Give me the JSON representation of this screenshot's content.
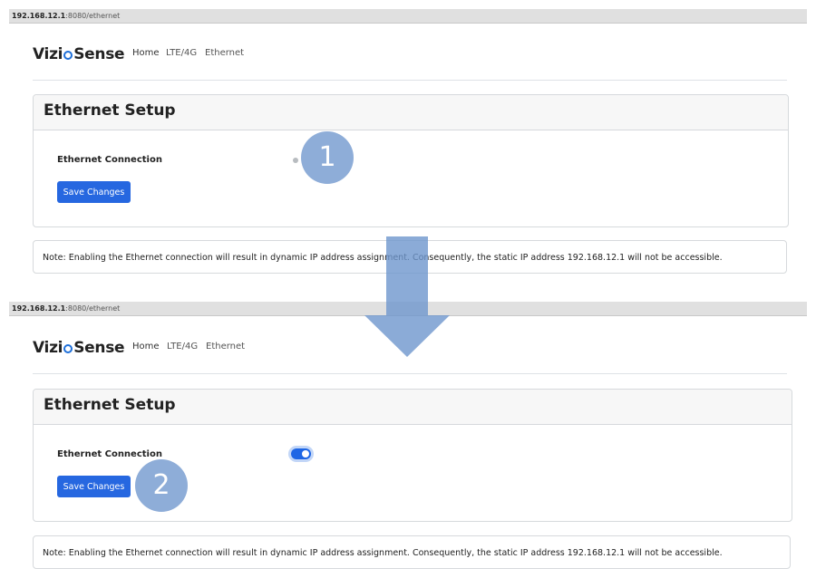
{
  "panels": [
    {
      "url": {
        "host": "192.168.12.1",
        "rest": ":8080/ethernet"
      },
      "brand": {
        "pre": "Vizi",
        "post": "Sense"
      },
      "nav": [
        "Home",
        "LTE/4G",
        "Ethernet"
      ],
      "card_title": "Ethernet Setup",
      "field_label": "Ethernet Connection",
      "toggle_state": "off",
      "save_label": "Save Changes",
      "note": "Note: Enabling the Ethernet connection will result in dynamic IP address assignment. Consequently, the static IP address 192.168.12.1 will not be accessible."
    },
    {
      "url": {
        "host": "192.168.12.1",
        "rest": ":8080/ethernet"
      },
      "brand": {
        "pre": "Vizi",
        "post": "Sense"
      },
      "nav": [
        "Home",
        "LTE/4G",
        "Ethernet"
      ],
      "card_title": "Ethernet Setup",
      "field_label": "Ethernet Connection",
      "toggle_state": "on",
      "save_label": "Save Changes",
      "note": "Note: Enabling the Ethernet connection will result in dynamic IP address assignment. Consequently, the static IP address 192.168.12.1 will not be accessible."
    }
  ],
  "annotations": {
    "step1": "1",
    "step2": "2",
    "arrow_icon": "down-arrow-icon"
  },
  "colors": {
    "primary": "#2667e0",
    "annotation": "#6e96cd"
  }
}
